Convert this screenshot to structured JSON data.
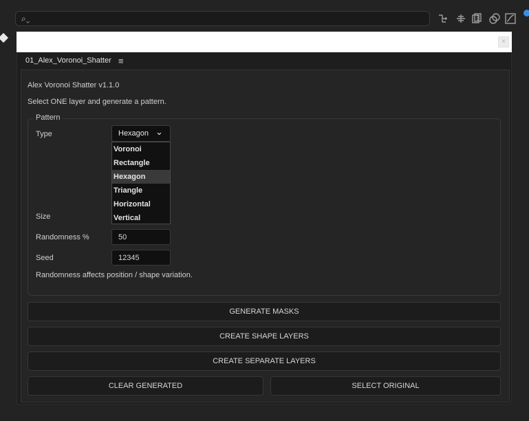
{
  "topbar": {
    "search_glyph": "⌕⌄",
    "icons": [
      "hierarchy-icon",
      "parent-link-icon",
      "frame-blend-icon",
      "motion-blur-icon",
      "graph-editor-icon"
    ]
  },
  "panel": {
    "tab_title": "01_Alex_Voronoi_Shatter",
    "menu_glyph": "≡",
    "heading": "Alex Voronoi Shatter  v1.1.0",
    "instruction": "Select ONE layer and generate a pattern."
  },
  "pattern": {
    "legend": "Pattern",
    "type_label": "Type",
    "type_value": "Hexagon",
    "type_options": [
      "Voronoi",
      "Rectangle",
      "Hexagon",
      "Triangle",
      "Horizontal",
      "Vertical"
    ],
    "size_label": "Size",
    "randomness_label": "Randomness %",
    "randomness_value": "50",
    "seed_label": "Seed",
    "seed_value": "12345",
    "note": "Randomness affects position / shape variation."
  },
  "buttons": {
    "generate_masks": "GENERATE MASKS",
    "create_shape_layers": "CREATE SHAPE LAYERS",
    "create_separate_layers": "CREATE SEPARATE LAYERS",
    "clear_generated": "CLEAR GENERATED",
    "select_original": "SELECT ORIGINAL"
  },
  "colors": {
    "background": "#232323",
    "panel": "#252525",
    "field": "#101010",
    "selected_option": "#3a3a3a",
    "accent_dot": "#3a8ee6"
  }
}
